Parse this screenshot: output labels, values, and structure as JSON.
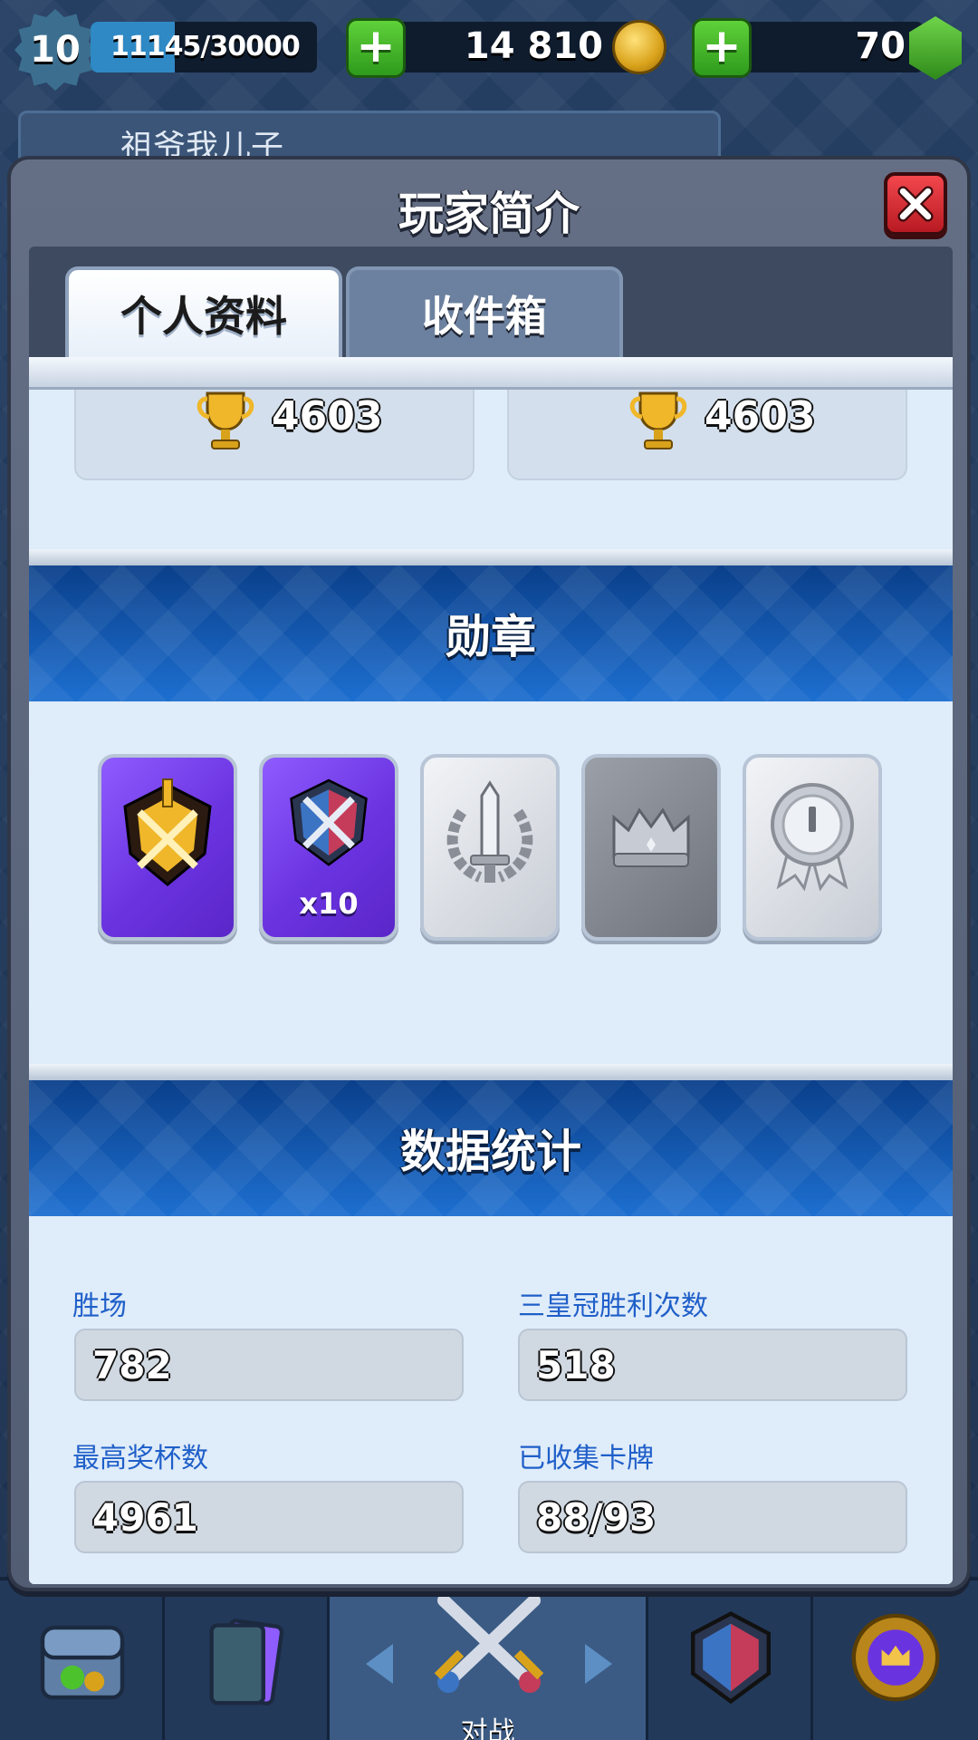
{
  "topbar": {
    "level": "10",
    "xp_text": "11145/30000",
    "xp_fraction": 0.3715,
    "gold": "14 810",
    "gems": "70"
  },
  "profile_row": {
    "player_name": "祖爷我儿子"
  },
  "modal": {
    "title": "玩家简介",
    "tabs": [
      {
        "label": "个人资料",
        "active": true
      },
      {
        "label": "收件箱",
        "active": false
      }
    ],
    "trophies": {
      "current": "4603",
      "season_best": "4603"
    },
    "badges_section": {
      "title": "勋章",
      "badges": [
        {
          "icon": "golden-swords-shield-icon",
          "style": "purple",
          "multiplier": ""
        },
        {
          "icon": "crossed-swords-shield-icon",
          "style": "purple",
          "multiplier": "x10"
        },
        {
          "icon": "sword-laurel-icon",
          "style": "silver",
          "multiplier": ""
        },
        {
          "icon": "crown-icon",
          "style": "dark",
          "multiplier": ""
        },
        {
          "icon": "medal-icon",
          "style": "silver",
          "multiplier": ""
        }
      ]
    },
    "stats_section": {
      "title": "数据统计",
      "items": [
        {
          "label": "胜场",
          "value": "782"
        },
        {
          "label": "三皇冠胜利次数",
          "value": "518"
        },
        {
          "label": "最高奖杯数",
          "value": "4961"
        },
        {
          "label": "已收集卡牌",
          "value": "88/93"
        }
      ]
    }
  },
  "bottom_nav": {
    "battle_label": "对战"
  },
  "colors": {
    "accent_blue": "#1d6fd0",
    "stat_label_blue": "#1f5fc9",
    "close_red": "#e0303a",
    "plus_green": "#4cc22c"
  }
}
